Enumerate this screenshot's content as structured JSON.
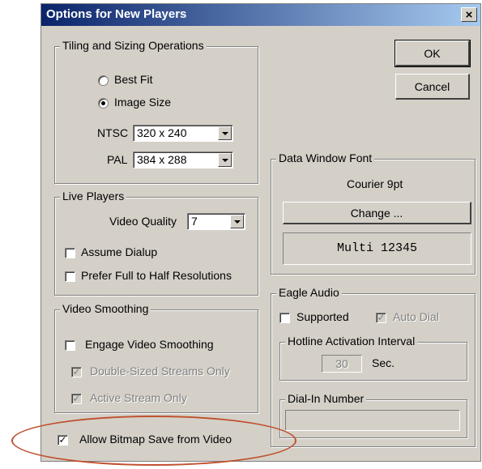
{
  "window": {
    "title": "Options for New Players",
    "close_glyph": "×"
  },
  "buttons": {
    "ok": "OK",
    "cancel": "Cancel"
  },
  "tiling": {
    "legend": "Tiling and Sizing Operations",
    "best_fit": "Best Fit",
    "image_size": "Image Size",
    "selected": "image_size",
    "ntsc_label": "NTSC",
    "ntsc_value": "320 x 240",
    "pal_label": "PAL",
    "pal_value": "384 x 288"
  },
  "live": {
    "legend": "Live Players",
    "quality_label": "Video Quality",
    "quality_value": "7",
    "assume_dialup": "Assume Dialup",
    "prefer_full": "Prefer Full to Half Resolutions"
  },
  "smoothing": {
    "legend": "Video Smoothing",
    "engage": "Engage Video Smoothing",
    "double_sized": "Double-Sized Streams Only",
    "active_stream": "Active Stream Only"
  },
  "bitmap": {
    "label": "Allow Bitmap Save from Video",
    "checked": true
  },
  "font": {
    "legend": "Data Window Font",
    "current": "Courier 9pt",
    "change": "Change ...",
    "preview": "Multi 12345"
  },
  "eagle": {
    "legend": "Eagle Audio",
    "supported": "Supported",
    "auto_dial": "Auto Dial",
    "hotline_legend": "Hotline Activation Interval",
    "hotline_value": "30",
    "hotline_unit": "Sec.",
    "dialin_legend": "Dial-In Number",
    "dialin_value": ""
  },
  "colors": {
    "title_start": "#0a246a",
    "title_end": "#a6caf0",
    "face": "#d4d0c8",
    "highlight_oval": "#c0502e"
  },
  "icons": {
    "checkmark": "check-icon",
    "dropdown": "chevron-down-icon"
  }
}
